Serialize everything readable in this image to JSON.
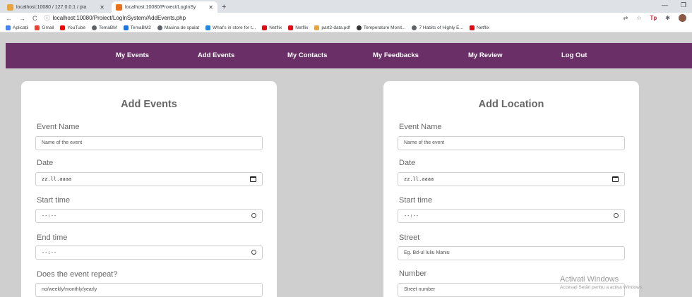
{
  "browser": {
    "tabs": [
      {
        "title": "localhost:10080 / 127.0.0.1 / pla",
        "active": false,
        "favicon_color": "#e8a33d"
      },
      {
        "title": "localhost:10080/Proiect/LogInSy",
        "active": true,
        "favicon_color": "#e8711a"
      }
    ],
    "new_tab": "+",
    "url": "localhost:10080/Proiect/LogInSystem/AddEvents.php",
    "bookmarks": [
      {
        "label": "Aplicații",
        "color": "#4285f4"
      },
      {
        "label": "Gmail",
        "color": "#ea4335"
      },
      {
        "label": "YouTube",
        "color": "#ff0000"
      },
      {
        "label": "TemaBM",
        "color": "#5f6368"
      },
      {
        "label": "TemaBM2",
        "color": "#1a73e8"
      },
      {
        "label": "Masina de spalat",
        "color": "#5f6368"
      },
      {
        "label": "What's in store for t...",
        "color": "#1e88e5"
      },
      {
        "label": "Netflix",
        "color": "#e50914"
      },
      {
        "label": "Netflix",
        "color": "#e50914"
      },
      {
        "label": "part2-data.pdf",
        "color": "#e8a33d"
      },
      {
        "label": "Temperature Monit...",
        "color": "#333333"
      },
      {
        "label": "7 Habits of Highly E...",
        "color": "#5f6368"
      },
      {
        "label": "Netflix",
        "color": "#e50914"
      }
    ]
  },
  "nav": {
    "items": [
      "My Events",
      "Add Events",
      "My Contacts",
      "My Feedbacks",
      "My Review",
      "Log Out"
    ],
    "color": "#6a2f66"
  },
  "add_events": {
    "title": "Add Events",
    "event_name_label": "Event Name",
    "event_name_placeholder": "Name of the event",
    "date_label": "Date",
    "date_value": "zz.ll.aaaa",
    "start_time_label": "Start time",
    "start_time_value": "--:--",
    "end_time_label": "End time",
    "end_time_value": "--:--",
    "repeat_label": "Does the event repeat?",
    "repeat_placeholder": "no/weekly/monthly/yearly"
  },
  "add_location": {
    "title": "Add Location",
    "event_name_label": "Event Name",
    "event_name_placeholder": "Name of the event",
    "date_label": "Date",
    "date_value": "zz.ll.aaaa",
    "start_time_label": "Start time",
    "start_time_value": "--:--",
    "street_label": "Street",
    "street_placeholder": "Eg. Bd-ul Iuliu Maniu",
    "number_label": "Number",
    "number_placeholder": "Street number"
  },
  "watermark": {
    "line1": "Activati Windows",
    "line2": "Accesați Setări pentru a activa Windows."
  }
}
